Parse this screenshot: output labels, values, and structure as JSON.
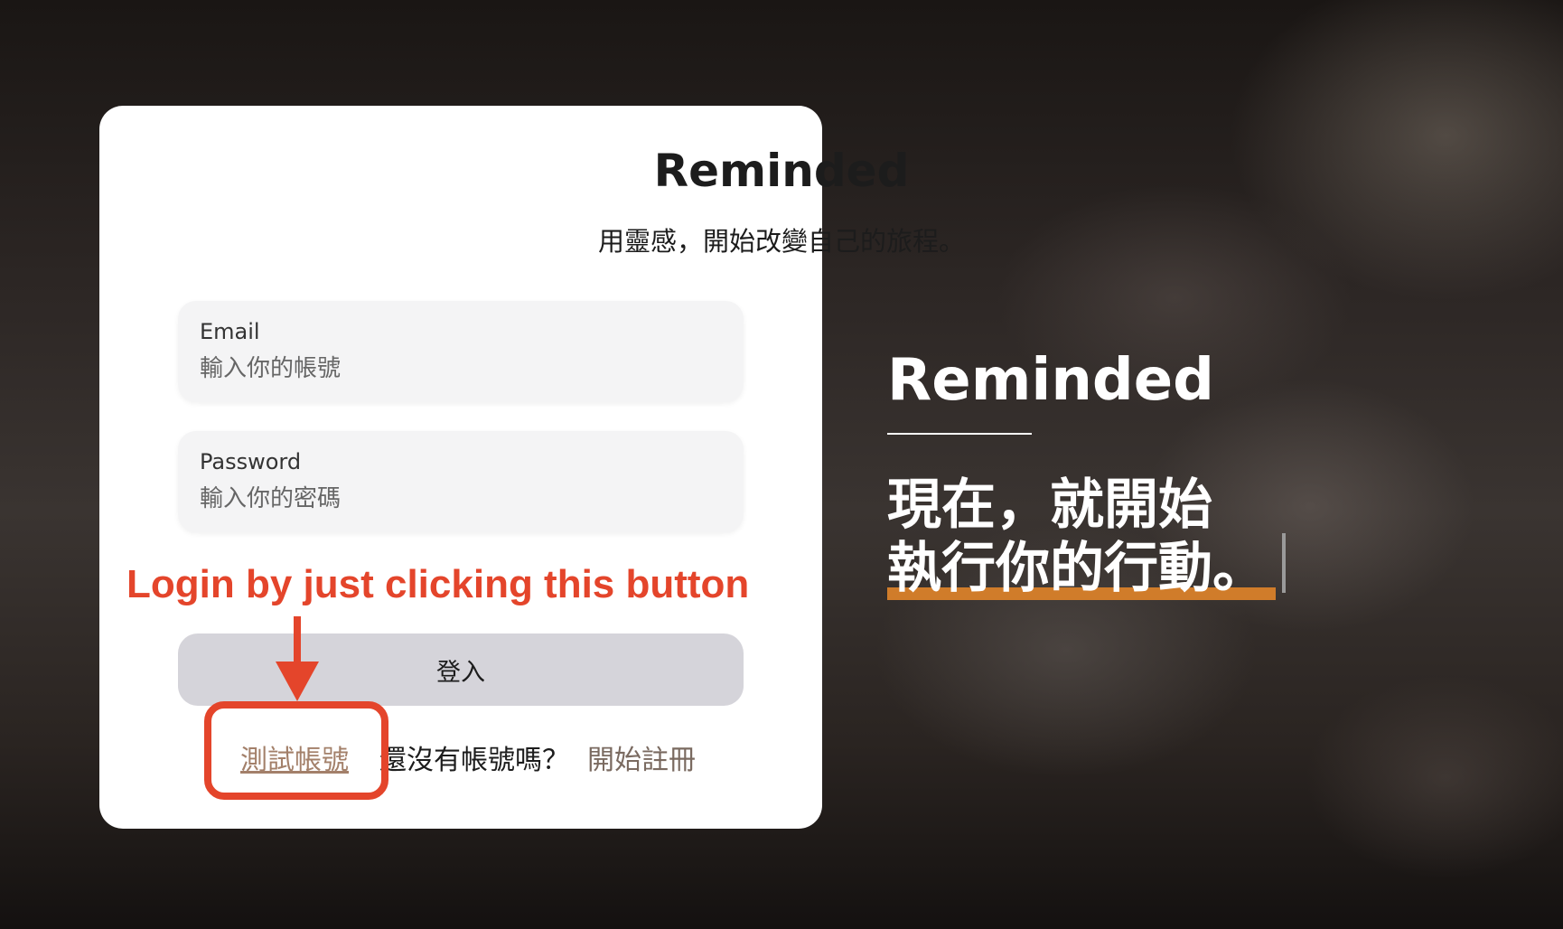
{
  "card": {
    "title": "Reminded",
    "subtitle": "用靈感，開始改變自己的旅程。"
  },
  "form": {
    "email": {
      "label": "Email",
      "placeholder": "輸入你的帳號",
      "value": ""
    },
    "password": {
      "label": "Password",
      "placeholder": "輸入你的密碼",
      "value": ""
    },
    "login_label": "登入",
    "test_account_label": "測試帳號",
    "signup_prompt": "還沒有帳號嗎？",
    "signup_label": "開始註冊"
  },
  "annotation": {
    "text": "Login by just clicking this button",
    "color": "#e4452b"
  },
  "hero": {
    "title": "Reminded",
    "line1": "現在，就開始",
    "line2": "執行你的行動。",
    "accent_color": "#d07c2a"
  }
}
